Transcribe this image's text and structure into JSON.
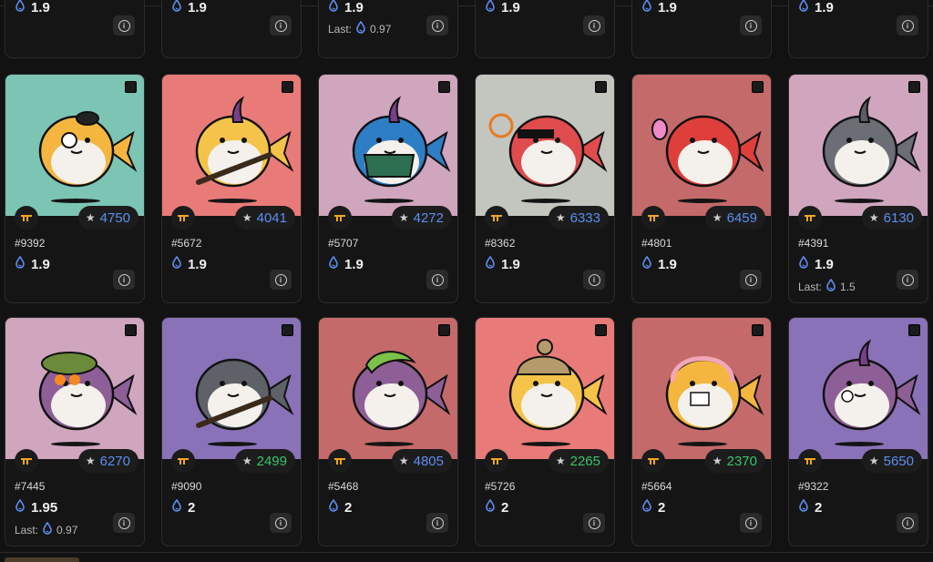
{
  "row0": [
    {
      "price": "1.9",
      "last_label": "",
      "last": ""
    },
    {
      "price": "1.9",
      "last_label": "",
      "last": ""
    },
    {
      "price": "1.9",
      "last_label": "Last:",
      "last": "0.97"
    },
    {
      "price": "1.9",
      "last_label": "",
      "last": ""
    },
    {
      "price": "1.9",
      "last_label": "",
      "last": ""
    },
    {
      "price": "1.9",
      "last_label": "",
      "last": ""
    }
  ],
  "row1": [
    {
      "id": "#9392",
      "rank": "4750",
      "rank_color": "blue",
      "price": "1.9",
      "bg": "#7cc4b4",
      "body": "#f5b640",
      "horn": "none",
      "acc": "hat-eyepatch",
      "last_label": "",
      "last": ""
    },
    {
      "id": "#5672",
      "rank": "4041",
      "rank_color": "blue",
      "price": "1.9",
      "bg": "#e87b78",
      "body": "#f5c24a",
      "horn": "#7a3f8c",
      "acc": "bat",
      "last_label": "",
      "last": ""
    },
    {
      "id": "#5707",
      "rank": "4272",
      "rank_color": "blue",
      "price": "1.9",
      "bg": "#d0a6bf",
      "body": "#2d7ec4",
      "horn": "#7a3f8c",
      "acc": "jacket",
      "last_label": "",
      "last": ""
    },
    {
      "id": "#8362",
      "rank": "6333",
      "rank_color": "blue",
      "price": "1.9",
      "bg": "#c2c6be",
      "body": "#e04b4e",
      "horn": "none",
      "acc": "glasses-target",
      "last_label": "",
      "last": ""
    },
    {
      "id": "#4801",
      "rank": "6459",
      "rank_color": "blue",
      "price": "1.9",
      "bg": "#c46a6a",
      "body": "#df3f3a",
      "horn": "none",
      "acc": "egg",
      "last_label": "",
      "last": ""
    },
    {
      "id": "#4391",
      "rank": "6130",
      "rank_color": "blue",
      "price": "1.9",
      "bg": "#d0a6bf",
      "body": "#6b6e74",
      "horn": "#5a5d63",
      "acc": "none",
      "last_label": "Last:",
      "last": "1.5"
    }
  ],
  "row2": [
    {
      "id": "#7445",
      "rank": "6270",
      "rank_color": "blue",
      "price": "1.95",
      "bg": "#d0a6bf",
      "body": "#8e5f96",
      "horn": "none",
      "acc": "helmet",
      "last_label": "Last:",
      "last": "0.97"
    },
    {
      "id": "#9090",
      "rank": "2499",
      "rank_color": "green",
      "price": "2",
      "bg": "#8a72b8",
      "body": "#5f6168",
      "horn": "none",
      "acc": "sword",
      "last_label": "",
      "last": ""
    },
    {
      "id": "#5468",
      "rank": "4805",
      "rank_color": "blue",
      "price": "2",
      "bg": "#c46a6a",
      "body": "#8e5f96",
      "horn": "none",
      "acc": "green-hair",
      "last_label": "",
      "last": ""
    },
    {
      "id": "#5726",
      "rank": "2265",
      "rank_color": "green",
      "price": "2",
      "bg": "#e87b78",
      "body": "#f5c24a",
      "horn": "none",
      "acc": "beanie",
      "last_label": "",
      "last": ""
    },
    {
      "id": "#5664",
      "rank": "2370",
      "rank_color": "green",
      "price": "2",
      "bg": "#c46a6a",
      "body": "#f5b640",
      "horn": "none",
      "acc": "headphones",
      "last_label": "",
      "last": ""
    },
    {
      "id": "#9322",
      "rank": "5650",
      "rank_color": "blue",
      "price": "2",
      "bg": "#8a72b8",
      "body": "#8e5f96",
      "horn": "#7a3f8c",
      "acc": "skull",
      "last_label": "",
      "last": ""
    }
  ],
  "icons": {
    "currency": "drop-icon",
    "info": "info-icon",
    "rank": "star-icon",
    "collection": "collection-logo-icon",
    "select": "checkbox-icon"
  },
  "info_glyph": "i",
  "star_glyph": "★"
}
